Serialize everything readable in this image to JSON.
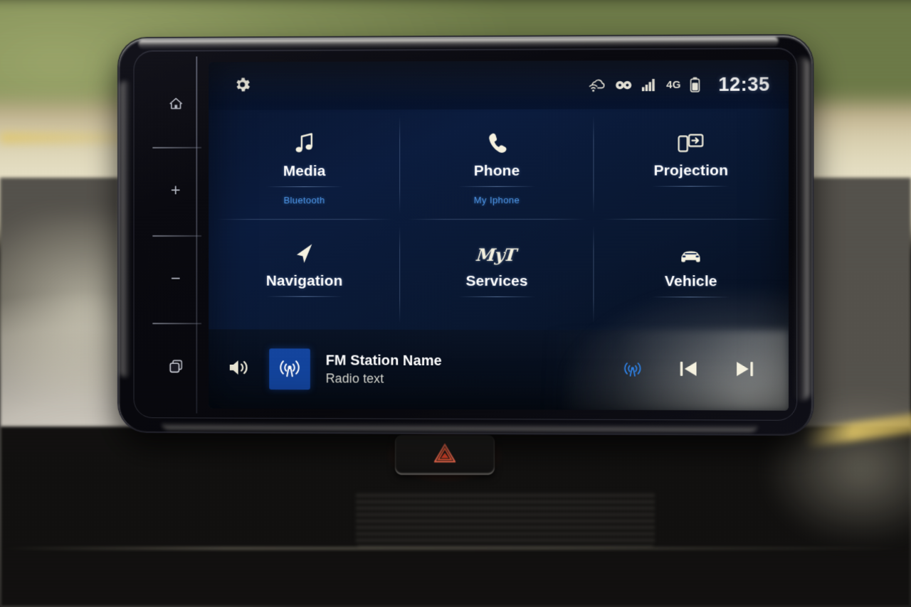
{
  "status_bar": {
    "settings_icon": "gear-icon",
    "icons": [
      {
        "name": "cloud-wifi-icon",
        "label": "Connected services"
      },
      {
        "name": "link-icon",
        "label": "Linked"
      },
      {
        "name": "signal-bars-icon",
        "label": "Signal"
      }
    ],
    "network_label": "4G",
    "battery_icon": "battery-icon",
    "clock": "12:35"
  },
  "hard_keys": [
    {
      "name": "home-key",
      "icon": "home-icon",
      "label": "Home"
    },
    {
      "name": "volume-up-key",
      "icon": "plus-icon",
      "label": "+"
    },
    {
      "name": "volume-down-key",
      "icon": "minus-icon",
      "label": "−"
    },
    {
      "name": "apps-key",
      "icon": "apps-icon",
      "label": "Apps"
    }
  ],
  "tiles": [
    {
      "id": "media",
      "label": "Media",
      "sub": "Bluetooth",
      "icon": "music-note-icon"
    },
    {
      "id": "phone",
      "label": "Phone",
      "sub": "My Iphone",
      "icon": "phone-handset-icon"
    },
    {
      "id": "projection",
      "label": "Projection",
      "sub": "",
      "icon": "screen-mirroring-icon"
    },
    {
      "id": "navigation",
      "label": "Navigation",
      "sub": "",
      "icon": "navigation-arrow-icon"
    },
    {
      "id": "services",
      "label": "Services",
      "sub": "",
      "icon": "myt-logo",
      "logo_text": "MyT"
    },
    {
      "id": "vehicle",
      "label": "Vehicle",
      "sub": "",
      "icon": "car-icon"
    }
  ],
  "media_bar": {
    "volume_icon": "speaker-volume-icon",
    "album_art_icon": "radio-broadcast-icon",
    "title": "FM Station Name",
    "subtitle": "Radio text",
    "source_icon": "radio-broadcast-icon",
    "prev_icon": "skip-previous-icon",
    "next_icon": "skip-next-icon"
  },
  "hazard_button": {
    "name": "hazard-warning-button",
    "icon": "hazard-triangle-icon"
  },
  "colors": {
    "accent_blue": "#14459e",
    "sub_blue": "#4f97e8",
    "source_blue": "#2f7fe0",
    "screen_bg_dark": "#06101f",
    "screen_bg_blue": "#0e2550",
    "text_primary": "#ffffff",
    "text_icon": "#f6f2e0",
    "hazard_red": "#e8452a"
  }
}
